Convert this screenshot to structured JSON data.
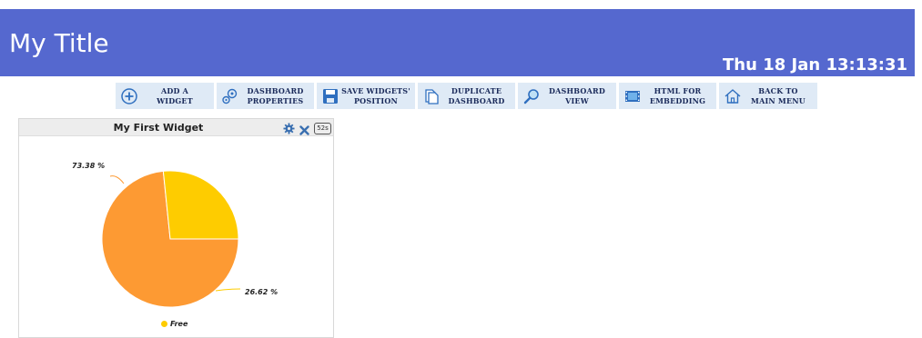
{
  "header": {
    "title": "My Title",
    "datetime": "Thu 18 Jan 13:13:31",
    "background": "#5568cf"
  },
  "toolbar": {
    "buttons": [
      {
        "label": "ADD A\nWIDGET",
        "icon": "plus-circle-icon"
      },
      {
        "label": "DASHBOARD\nPROPERTIES",
        "icon": "gears-icon"
      },
      {
        "label": "SAVE WIDGETS'\nPOSITION",
        "icon": "save-disk-icon"
      },
      {
        "label": "DUPLICATE\nDASHBOARD",
        "icon": "copy-pages-icon"
      },
      {
        "label": "DASHBOARD\nVIEW",
        "icon": "magnifier-icon"
      },
      {
        "label": "HTML FOR\nEMBEDDING",
        "icon": "film-frame-icon"
      },
      {
        "label": "BACK TO\nMAIN MENU",
        "icon": "home-icon"
      }
    ]
  },
  "widget": {
    "title": "My First Widget",
    "refresh_interval": "52s",
    "settings_icon": "gear-icon",
    "close_icon": "close-icon"
  },
  "chart_data": {
    "type": "pie",
    "slices": [
      {
        "name": "Free",
        "value": 73.38,
        "label": "73.38 %",
        "color": "#fd9a33"
      },
      {
        "name": "",
        "value": 26.62,
        "label": "26.62 %",
        "color": "#fecc00"
      }
    ],
    "legend": [
      {
        "name": "Free",
        "color": "#fecc00"
      }
    ],
    "legend_position": "bottom"
  }
}
